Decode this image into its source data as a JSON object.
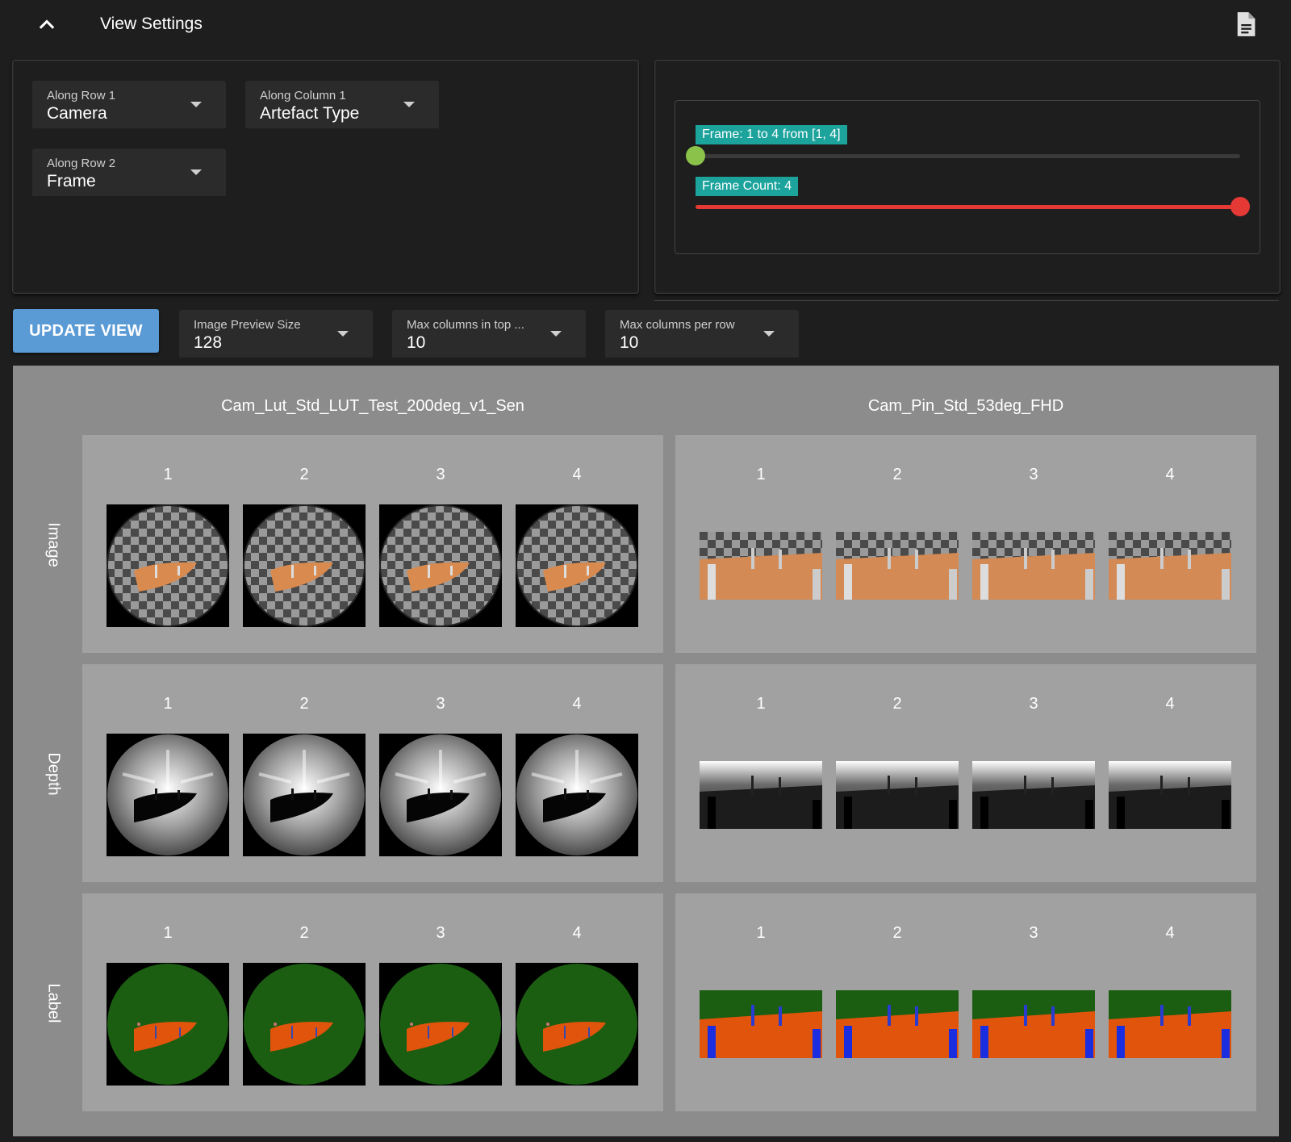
{
  "header": {
    "title": "View Settings",
    "collapse_icon": "chevron-up-icon",
    "doc_icon": "document-icon"
  },
  "layout_selects": [
    {
      "label": "Along Row 1",
      "value": "Camera"
    },
    {
      "label": "Along Column 1",
      "value": "Artefact Type"
    },
    {
      "label": "Along Row 2",
      "value": "Frame"
    }
  ],
  "sliders": {
    "frame_range": {
      "label": "Frame: 1 to 4 from [1, 4]",
      "min": 1,
      "max": 4,
      "start": 1,
      "end": 4
    },
    "frame_count": {
      "label": "Frame Count: 4",
      "value": 4,
      "fraction": 1.0
    }
  },
  "toolbar": {
    "update_label": "UPDATE VIEW",
    "selects": [
      {
        "label": "Image Preview Size",
        "value": "128"
      },
      {
        "label": "Max columns in top ...",
        "value": "10"
      },
      {
        "label": "Max columns per row",
        "value": "10"
      }
    ]
  },
  "grid": {
    "columns": [
      "Cam_Lut_Std_LUT_Test_200deg_v1_Sen",
      "Cam_Pin_Std_53deg_FHD"
    ],
    "rows": [
      "Image",
      "Depth",
      "Label"
    ],
    "frames": [
      "1",
      "2",
      "3",
      "4"
    ]
  },
  "colors": {
    "accent_blue": "#5b9bd5",
    "chip_teal": "#1ba39c",
    "slider_green": "#8bc34a",
    "slider_red": "#e53935"
  }
}
